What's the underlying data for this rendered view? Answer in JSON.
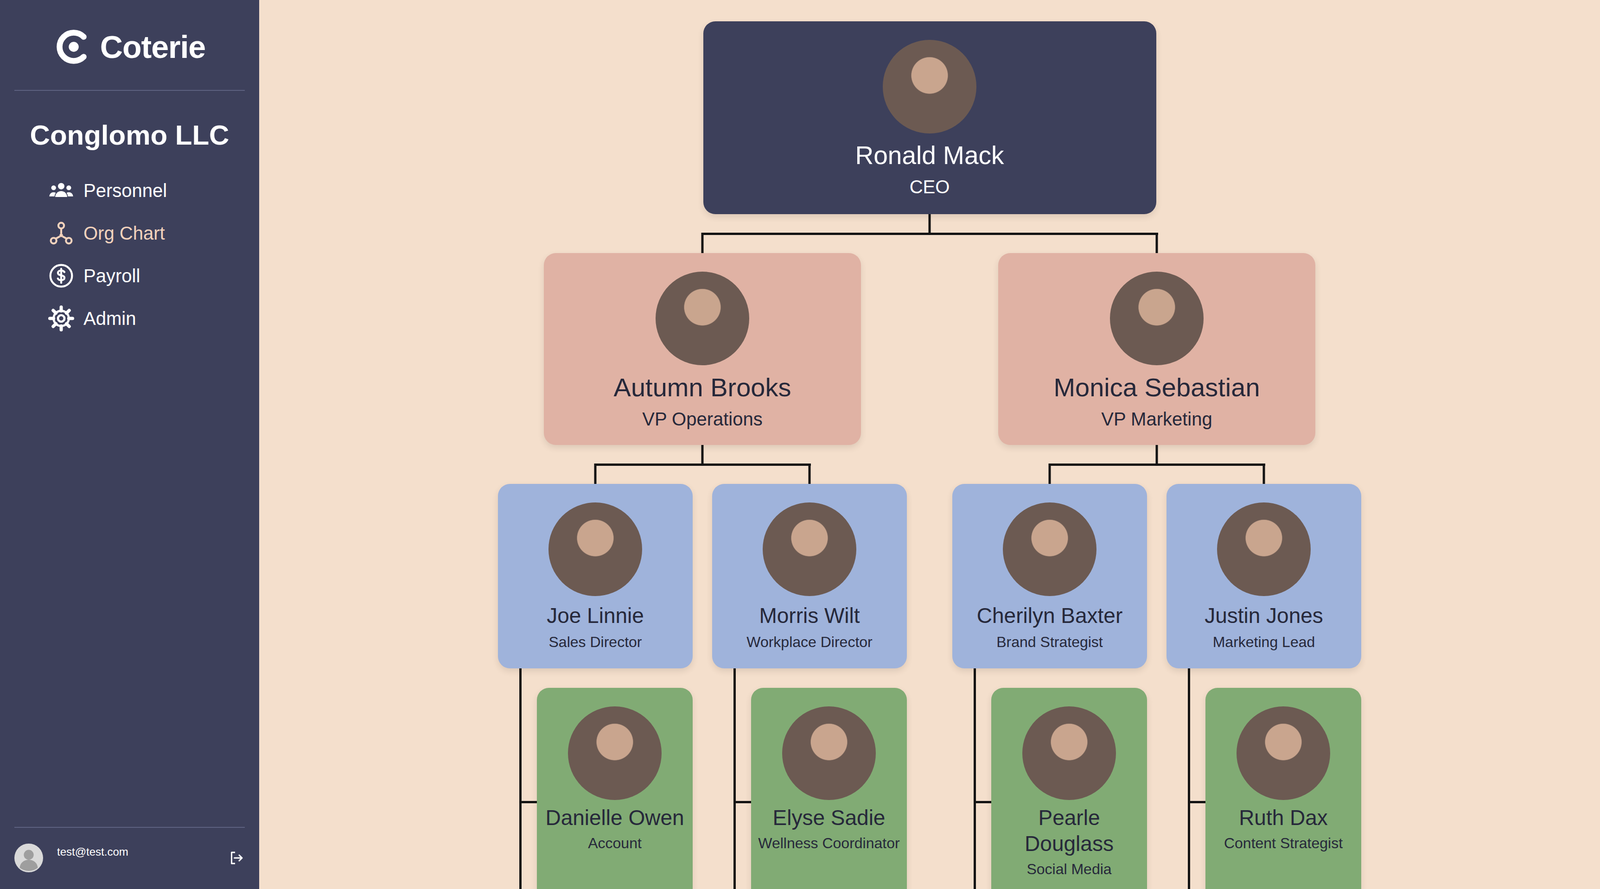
{
  "brand": {
    "name": "Coterie"
  },
  "company": "Conglomo LLC",
  "nav": [
    {
      "label": "Personnel",
      "kind": "personnel",
      "selected": false
    },
    {
      "label": "Org Chart",
      "kind": "orgchart",
      "selected": true
    },
    {
      "label": "Payroll",
      "kind": "payroll",
      "selected": false
    },
    {
      "label": "Admin",
      "kind": "admin",
      "selected": false
    }
  ],
  "user": {
    "email": "test@test.com"
  },
  "org": {
    "name": "Ronald Mack",
    "title": "CEO",
    "children": [
      {
        "name": "Autumn Brooks",
        "title": "VP Operations",
        "children": [
          {
            "name": "Joe Linnie",
            "title": "Sales Director",
            "reports": [
              {
                "name": "Danielle Owen",
                "title": "Account"
              }
            ]
          },
          {
            "name": "Morris Wilt",
            "title": "Workplace Director",
            "reports": [
              {
                "name": "Elyse Sadie",
                "title": "Wellness Coordinator"
              }
            ]
          }
        ]
      },
      {
        "name": "Monica Sebastian",
        "title": "VP Marketing",
        "children": [
          {
            "name": "Cherilyn Baxter",
            "title": "Brand Strategist",
            "reports": [
              {
                "name": "Pearle Douglass",
                "title": "Social Media"
              }
            ]
          },
          {
            "name": "Justin Jones",
            "title": "Marketing Lead",
            "reports": [
              {
                "name": "Ruth Dax",
                "title": "Content Strategist"
              }
            ]
          }
        ]
      }
    ]
  }
}
